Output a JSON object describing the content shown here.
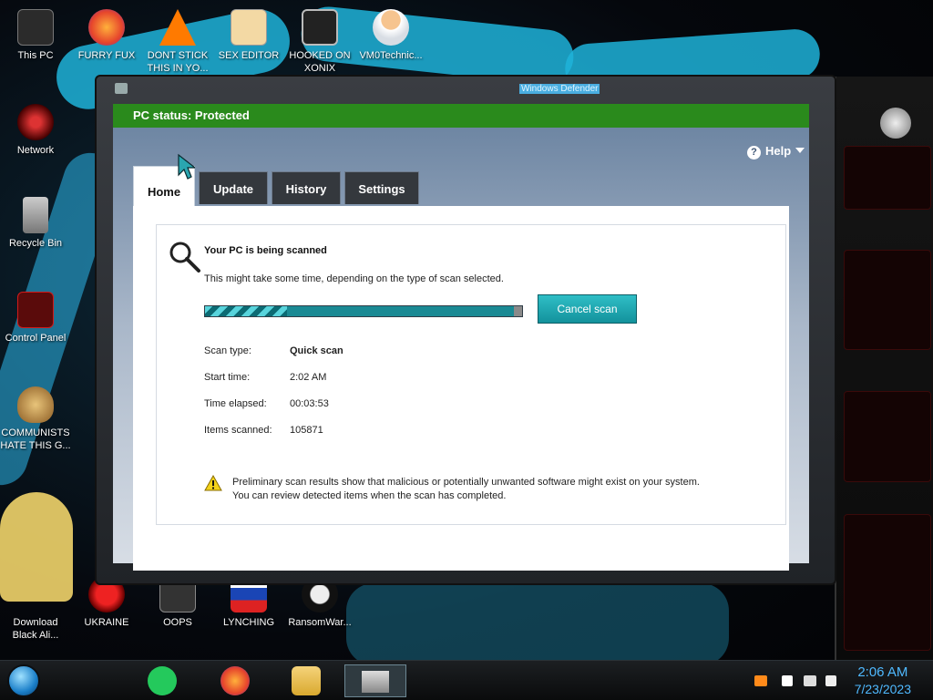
{
  "desktop": {
    "icons_top": [
      {
        "label": "This PC",
        "icon": "computer-icon"
      },
      {
        "label": "FURRY FUX",
        "icon": "firefox-icon"
      },
      {
        "label": "DONT STICK THIS IN YO...",
        "icon": "vlc-icon"
      },
      {
        "label": "SEX EDITOR",
        "icon": "xd-icon"
      },
      {
        "label": "HOOKED ON XONIX",
        "icon": "game-icon"
      },
      {
        "label": "VM0Technic...",
        "icon": "doctor-icon"
      }
    ],
    "icons_left": [
      {
        "label": "Network",
        "icon": "network-icon"
      },
      {
        "label": "Recycle Bin",
        "icon": "recycle-bin-icon"
      },
      {
        "label": "Control Panel",
        "icon": "control-panel-icon"
      },
      {
        "label": "COMMUNISTS HATE THIS G...",
        "icon": "money-bag-icon"
      },
      {
        "label": "Download Black Ali...",
        "icon": "download-icon"
      }
    ],
    "icons_bottom": [
      {
        "label": "UKRAINE",
        "icon": "ukraine-icon"
      },
      {
        "label": "OOPS",
        "icon": "oops-icon"
      },
      {
        "label": "LYNCHING",
        "icon": "lynching-icon"
      },
      {
        "label": "RansomWar...",
        "icon": "skull-icon"
      }
    ]
  },
  "window": {
    "title": "Windows Defender",
    "status": "PC status: Protected",
    "tabs": [
      {
        "label": "Home",
        "active": true
      },
      {
        "label": "Update",
        "active": false
      },
      {
        "label": "History",
        "active": false
      },
      {
        "label": "Settings",
        "active": false
      }
    ],
    "help_label": "Help",
    "scan": {
      "heading": "Your PC is being scanned",
      "subtitle": "This might take some time, depending on the type of scan selected.",
      "progress_fraction": 0.26,
      "cancel_label": "Cancel scan",
      "details": [
        {
          "label": "Scan type:",
          "value": "Quick scan",
          "bold": true
        },
        {
          "label": "Start time:",
          "value": "2:02 AM",
          "bold": false
        },
        {
          "label": "Time elapsed:",
          "value": "00:03:53",
          "bold": false
        },
        {
          "label": "Items scanned:",
          "value": "105871",
          "bold": false
        }
      ],
      "warning_line1": "Preliminary scan results show that malicious or potentially unwanted software might exist on your system.",
      "warning_line2": "You can review detected items when the scan has completed."
    }
  },
  "taskbar": {
    "time": "2:06 AM",
    "date": "7/23/2023"
  },
  "colors": {
    "status_green": "#2a8a1c",
    "accent_teal": "#1b9ea7",
    "clock_blue": "#4fb9ff"
  }
}
